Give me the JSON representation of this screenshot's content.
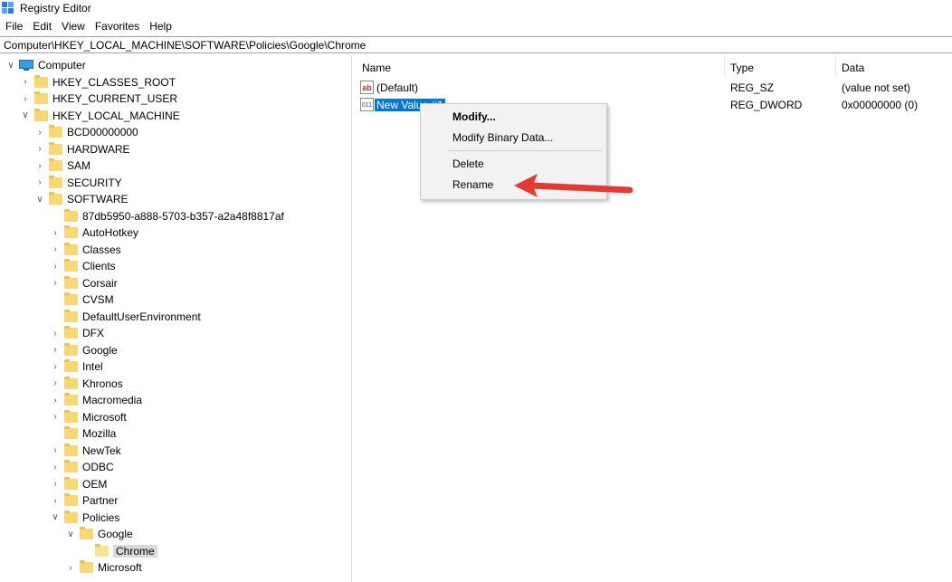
{
  "window": {
    "title": "Registry Editor"
  },
  "menu": [
    "File",
    "Edit",
    "View",
    "Favorites",
    "Help"
  ],
  "address": "Computer\\HKEY_LOCAL_MACHINE\\SOFTWARE\\Policies\\Google\\Chrome",
  "tree": {
    "root": "Computer",
    "hives": [
      "HKEY_CLASSES_ROOT",
      "HKEY_CURRENT_USER",
      "HKEY_LOCAL_MACHINE"
    ],
    "hklm_children": [
      "BCD00000000",
      "HARDWARE",
      "SAM",
      "SECURITY",
      "SOFTWARE"
    ],
    "software_children": [
      "87db5950-a888-5703-b357-a2a48f8817af",
      "AutoHotkey",
      "Classes",
      "Clients",
      "Corsair",
      "CVSM",
      "DefaultUserEnvironment",
      "DFX",
      "Google",
      "Intel",
      "Khronos",
      "Macromedia",
      "Microsoft",
      "Mozilla",
      "NewTek",
      "ODBC",
      "OEM",
      "Partner",
      "Policies"
    ],
    "policies_children": [
      "Google",
      "Microsoft"
    ],
    "google_children": [
      "Chrome"
    ],
    "selected": "Chrome"
  },
  "columns": {
    "name": "Name",
    "type": "Type",
    "data": "Data"
  },
  "values": [
    {
      "icon": "string-value-icon",
      "glyph": "ab",
      "name": "(Default)",
      "type": "REG_SZ",
      "data": "(value not set)"
    },
    {
      "icon": "dword-value-icon",
      "glyph": "011",
      "name": "New Value #1",
      "type": "REG_DWORD",
      "data": "0x00000000 (0)"
    }
  ],
  "context_menu": {
    "modify": "Modify...",
    "modify_binary": "Modify Binary Data...",
    "delete": "Delete",
    "rename": "Rename"
  },
  "colors": {
    "selection": "#0078d7",
    "arrow": "#e53935",
    "folder": "#f8d775"
  }
}
